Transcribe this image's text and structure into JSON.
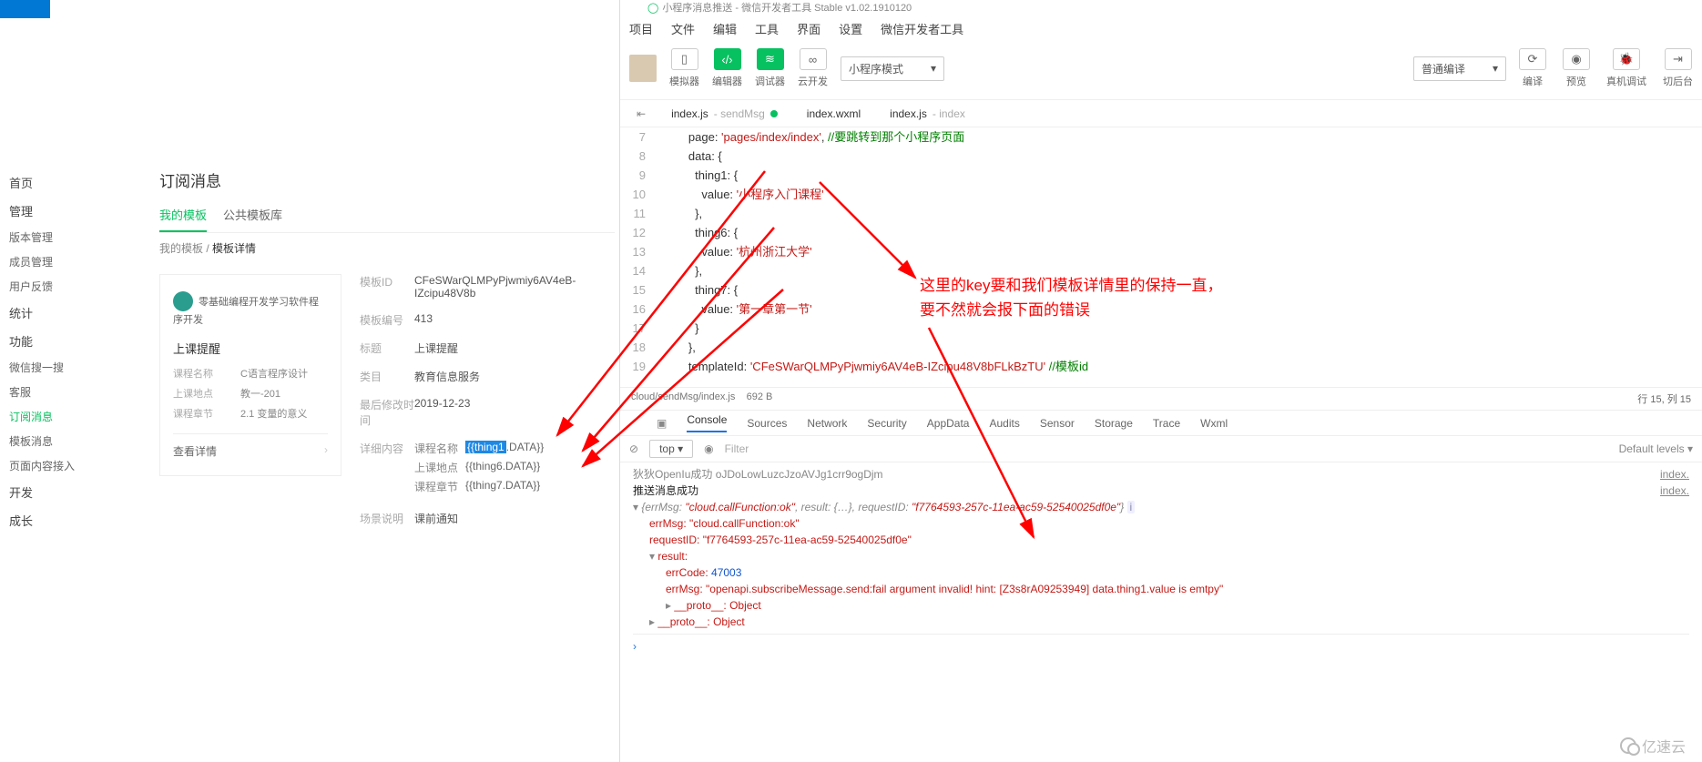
{
  "ide_title_prefix": "小程序消息推送 - 微信开发者工具 Stable v1.02.1910120",
  "menubar": [
    "项目",
    "文件",
    "编辑",
    "工具",
    "界面",
    "设置",
    "微信开发者工具"
  ],
  "toolbar": {
    "simulator": "模拟器",
    "editor": "编辑器",
    "debugger": "调试器",
    "cloud": "云开发",
    "mode": "小程序模式",
    "compile_mode": "普通编译",
    "compile": "编译",
    "preview": "预览",
    "remote": "真机调试",
    "background": "切后台"
  },
  "filetabs": [
    {
      "name": "index.js",
      "suffix": "sendMsg",
      "dirty": true
    },
    {
      "name": "index.wxml",
      "suffix": "",
      "dirty": false
    },
    {
      "name": "index.js",
      "suffix": "index",
      "dirty": false
    }
  ],
  "code": {
    "l7": "        page: 'pages/index/index', //要跳转到那个小程序页面",
    "l8": "        data: {",
    "l9": "          thing1: {",
    "l10": "            value: '小程序入门课程'",
    "l11": "          },",
    "l12": "          thing6: {",
    "l13": "            value: '杭州浙江大学'",
    "l14": "          },",
    "l15": "          thing7: {",
    "l16": "            value: '第一章第一节'",
    "l17": "          }",
    "l18": "        },",
    "l19": "        templateId: 'CFeSWarQLMPyPjwmiy6AV4eB-IZcipu48V8bFLkBzTU' //模板id"
  },
  "first_line_no": "7",
  "annotation_l1": "这里的key要和我们模板详情里的保持一直，",
  "annotation_l2": "要不然就会报下面的错误",
  "status": {
    "path": "cloud/sendMsg/index.js",
    "size": "692 B",
    "pos": "行 15, 列 15"
  },
  "devtabs": [
    "Console",
    "Sources",
    "Network",
    "Security",
    "AppData",
    "Audits",
    "Sensor",
    "Storage",
    "Trace",
    "Wxml"
  ],
  "devbar": {
    "ctx": "top",
    "filter_ph": "Filter",
    "levels": "Default levels ▾"
  },
  "console": {
    "ln0": "狄狄OpenIu成功  oJDoLowLuzcJzoAVJg1crr9ogDjm",
    "ln1": "推送消息成功",
    "ln2_pre": "{errMsg: ",
    "ln2_a": "\"cloud.callFunction:ok\"",
    "ln2_mid": ", result: {…}, requestID: ",
    "ln2_b": "\"f7764593-257c-11ea-ac59-52540025df0e\"",
    "ln2_post": "}",
    "ln3_k": "errMsg: ",
    "ln3_v": "\"cloud.callFunction:ok\"",
    "ln4_k": "requestID: ",
    "ln4_v": "\"f7764593-257c-11ea-ac59-52540025df0e\"",
    "ln5": "result:",
    "ln6_k": "errCode: ",
    "ln6_v": "47003",
    "ln7_k": "errMsg: ",
    "ln7_v": "\"openapi.subscribeMessage.send:fail argument invalid! hint: [Z3s8rA09253949] data.thing1.value is emtpy\"",
    "ln8": "__proto__: Object",
    "ln9": "__proto__: Object",
    "src1": "index.",
    "src2": "index."
  },
  "left": {
    "title": "订阅消息",
    "tabs": [
      "我的模板",
      "公共模板库"
    ],
    "crumb_a": "我的模板",
    "crumb_b": "模板详情",
    "nav": {
      "g1": "首页",
      "g2": "管理",
      "g2i": [
        "版本管理",
        "成员管理",
        "用户反馈"
      ],
      "g3": "统计",
      "g4": "功能",
      "g4i": [
        "微信搜一搜",
        "客服",
        "订阅消息",
        "模板消息",
        "页面内容接入"
      ],
      "g5": "开发",
      "g6": "成长"
    },
    "card": {
      "app": "零基础编程开发学习软件程序开发",
      "title": "上课提醒",
      "rows": [
        [
          "课程名称",
          "C语言程序设计"
        ],
        [
          "上课地点",
          "教一-201"
        ],
        [
          "课程章节",
          "2.1 变量的意义"
        ]
      ],
      "foot": "查看详情"
    },
    "detail": {
      "id_k": "模板ID",
      "id_v": "CFeSWarQLMPyPjwmiy6AV4eB-IZcipu48V8b",
      "no_k": "模板编号",
      "no_v": "413",
      "title_k": "标题",
      "title_v": "上课提醒",
      "cat_k": "类目",
      "cat_v": "教育信息服务",
      "time_k": "最后修改时间",
      "time_v": "2019-12-23",
      "body_k": "详细内容",
      "b1_k": "课程名称",
      "b1_sel": "{{thing1",
      "b1_rest": ".DATA}}",
      "b2_k": "上课地点",
      "b2_v": "{{thing6.DATA}}",
      "b3_k": "课程章节",
      "b3_v": "{{thing7.DATA}}",
      "scene_k": "场景说明",
      "scene_v": "课前通知"
    }
  },
  "watermark": "亿速云"
}
